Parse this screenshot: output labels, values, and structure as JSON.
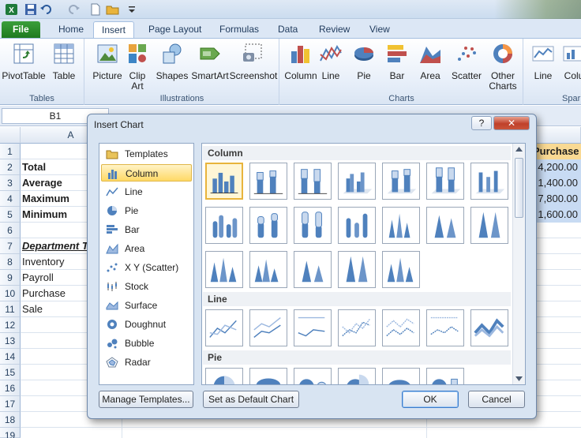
{
  "qat": {
    "icons": [
      "save-icon",
      "undo-icon",
      "redo-icon",
      "new-icon",
      "open-icon",
      "customize-icon"
    ]
  },
  "tabs": [
    "File",
    "Home",
    "Insert",
    "Page Layout",
    "Formulas",
    "Data",
    "Review",
    "View"
  ],
  "active_tab": "Insert",
  "ribbon": {
    "groups": {
      "tables": "Tables",
      "illustrations": "Illustrations",
      "charts": "Charts",
      "sparklines": "Sparkl"
    },
    "buttons": {
      "pivottable": "PivotTable",
      "table": "Table",
      "picture": "Picture",
      "clipart_1": "Clip",
      "clipart_2": "Art",
      "shapes": "Shapes",
      "smartart": "SmartArt",
      "screenshot": "Screenshot",
      "column": "Column",
      "line": "Line",
      "pie": "Pie",
      "bar": "Bar",
      "area": "Area",
      "scatter": "Scatter",
      "other_1": "Other",
      "other_2": "Charts",
      "spark_line": "Line",
      "spark_column": "Colu"
    }
  },
  "formula_bar": {
    "name_box": "B1"
  },
  "sheet": {
    "col_a": "A",
    "rows": [
      "1",
      "2",
      "3",
      "4",
      "5",
      "6",
      "7",
      "8",
      "9",
      "10",
      "11",
      "12",
      "13",
      "14",
      "15",
      "16",
      "17",
      "18",
      "19"
    ],
    "cells_a": {
      "r2": "Total",
      "r3": "Average",
      "r4": "Maximum",
      "r5": "Minimum",
      "r7": "Department T",
      "r8": "Inventory",
      "r9": "Payroll",
      "r10": "Purchase",
      "r11": "Sale"
    },
    "right_col": {
      "r1": "Purchase",
      "r2": "4,200.00",
      "r3": "1,400.00",
      "r4": "7,800.00",
      "r5": "1,600.00"
    }
  },
  "dialog": {
    "title": "Insert Chart",
    "help": "?",
    "close": "✕",
    "types": [
      "Templates",
      "Column",
      "Line",
      "Pie",
      "Bar",
      "Area",
      "X Y (Scatter)",
      "Stock",
      "Surface",
      "Doughnut",
      "Bubble",
      "Radar"
    ],
    "selected_type": "Column",
    "sections": {
      "column": "Column",
      "line": "Line",
      "pie": "Pie"
    },
    "buttons": {
      "manage": "Manage Templates...",
      "default": "Set as Default Chart",
      "ok": "OK",
      "cancel": "Cancel"
    }
  },
  "colors": {
    "accent": "#4f81bd",
    "file_tab": "#2a8a2a",
    "selection": "#ffd966"
  }
}
